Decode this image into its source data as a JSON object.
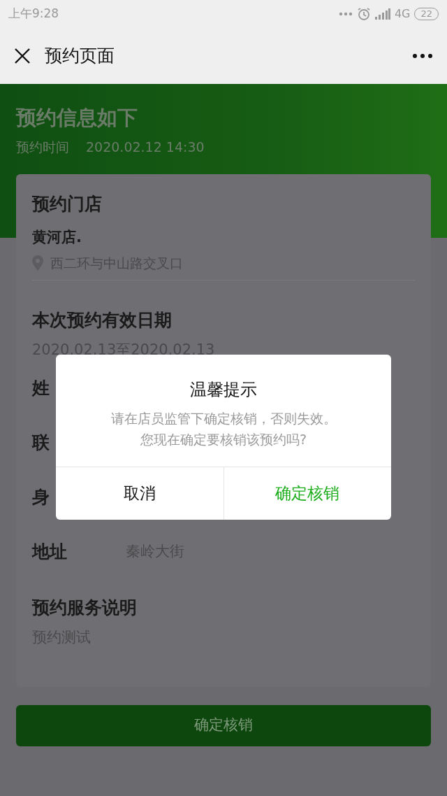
{
  "status_bar": {
    "time": "上午9:28",
    "network": "4G",
    "battery": "22"
  },
  "nav": {
    "title": "预约页面"
  },
  "header": {
    "title": "预约信息如下",
    "time_label": "预约时间",
    "time_value": "2020.02.12 14:30"
  },
  "store": {
    "label": "预约门店",
    "name": "黄河店.",
    "address": "西二环与中山路交叉口"
  },
  "validity": {
    "label": "本次预约有效日期",
    "value": "2020.02.13至2020.02.13"
  },
  "fields": [
    {
      "label": "姓"
    },
    {
      "label": "联"
    },
    {
      "label": "身"
    },
    {
      "label": "地址",
      "value": "秦岭大街"
    }
  ],
  "service": {
    "label": "预约服务说明",
    "value": "预约测试"
  },
  "submit_button": "确定核销",
  "dialog": {
    "title": "温馨提示",
    "message": [
      "请在店员监管下确定核销，否则失效。",
      "您现在确定要核销该预约吗?"
    ],
    "cancel": "取消",
    "confirm": "确定核销"
  }
}
